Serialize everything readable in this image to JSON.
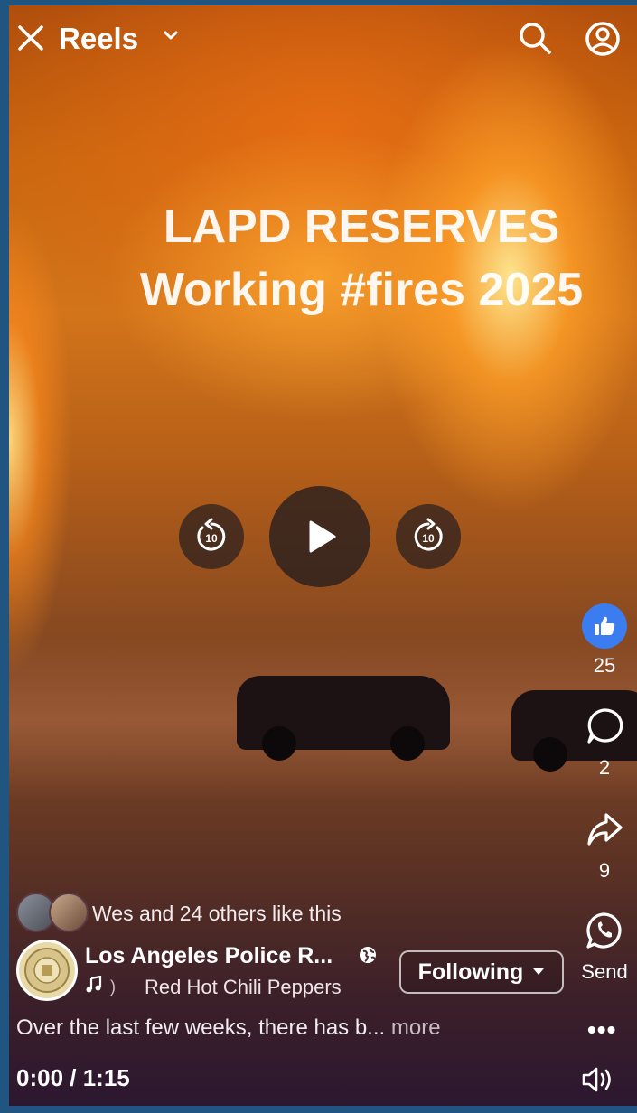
{
  "header": {
    "title": "Reels"
  },
  "video": {
    "overlay_line1": "LAPD RESERVES",
    "overlay_line2": "Working #fires 2025",
    "rewind_label": "10",
    "forward_label": "10"
  },
  "actions": {
    "like_count": "25",
    "comment_count": "2",
    "share_count": "9",
    "send_label": "Send"
  },
  "likers": {
    "text": "Wes and 24 others like this"
  },
  "post": {
    "page_name": "Los Angeles Police R...",
    "music_sep": ")",
    "music": "Red Hot Chili Peppers",
    "follow_label": "Following",
    "caption": "Over the last few weeks, there has b...",
    "more_label": "more",
    "more_menu": "•••"
  },
  "playback": {
    "time": "0:00 / 1:15"
  },
  "colors": {
    "like_blue": "#3b7cf0",
    "background_frame": "#1f5580"
  }
}
